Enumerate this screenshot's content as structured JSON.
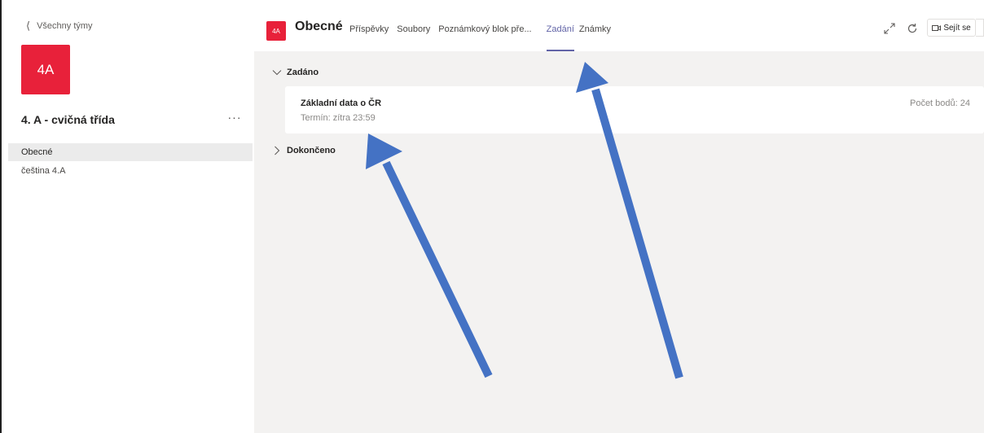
{
  "colors": {
    "team_red": "#e8213a",
    "accent": "#6264a7",
    "arrow_blue": "#4472c4"
  },
  "sidebar": {
    "back_label": "Všechny týmy",
    "team_avatar_text": "4A",
    "team_name": "4. A - cvičná třída",
    "more_label": "···",
    "channels": [
      {
        "label": "Obecné",
        "active": true
      },
      {
        "label": "čeština 4.A",
        "active": false
      }
    ]
  },
  "header": {
    "avatar_text": "4A",
    "channel_title": "Obecné",
    "tabs": [
      {
        "label": "Příspěvky",
        "active": false
      },
      {
        "label": "Soubory",
        "active": false
      },
      {
        "label": "Poznámkový blok pře...",
        "active": false
      },
      {
        "label": "Zadání",
        "active": true
      },
      {
        "label": "Známky",
        "active": false
      }
    ],
    "meet_label": "Sejít se",
    "icons": [
      "expand-icon",
      "refresh-icon",
      "video-icon",
      "chevron-down-icon"
    ]
  },
  "assignments": {
    "assigned_section": "Zadáno",
    "completed_section": "Dokončeno",
    "items": [
      {
        "title": "Základní data o ČR",
        "due": "Termín: zítra 23:59",
        "points": "Počet bodů: 24"
      }
    ]
  }
}
